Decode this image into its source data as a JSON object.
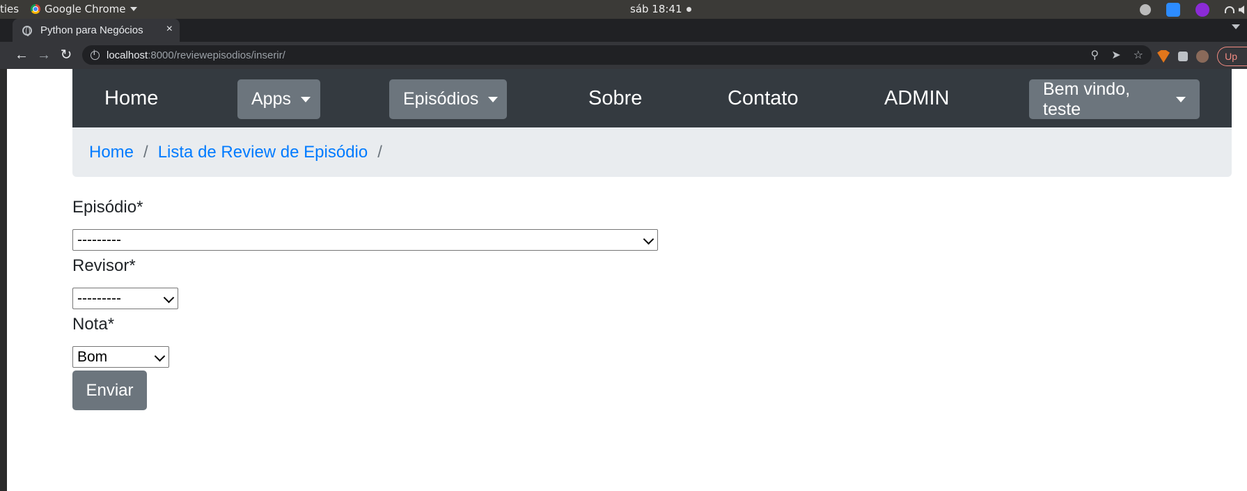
{
  "os": {
    "activities": "ties",
    "app_name": "Google Chrome",
    "clock": "sáb 18:41"
  },
  "browser": {
    "tab_title": "Python para Negócios",
    "tab_close": "×",
    "new_tab": "+",
    "url_host": "localhost",
    "url_rest": ":8000/reviewepisodios/inserir/",
    "update_label": "Up"
  },
  "navbar": {
    "home": "Home",
    "apps": "Apps",
    "episodios": "Episódios",
    "sobre": "Sobre",
    "contato": "Contato",
    "admin": "ADMIN",
    "user_menu": "Bem vindo, teste"
  },
  "breadcrumb": {
    "home": "Home",
    "list": "Lista de Review de Episódio",
    "separator": "/"
  },
  "form": {
    "episodio_label": "Episódio*",
    "episodio_value": "---------",
    "revisor_label": "Revisor*",
    "revisor_value": "---------",
    "nota_label": "Nota*",
    "nota_value": "Bom",
    "submit_label": "Enviar"
  },
  "colors": {
    "navbar_bg": "#343a40",
    "dropdown_bg": "#6c757d",
    "breadcrumb_bg": "#e9ecef",
    "link": "#007bff"
  }
}
